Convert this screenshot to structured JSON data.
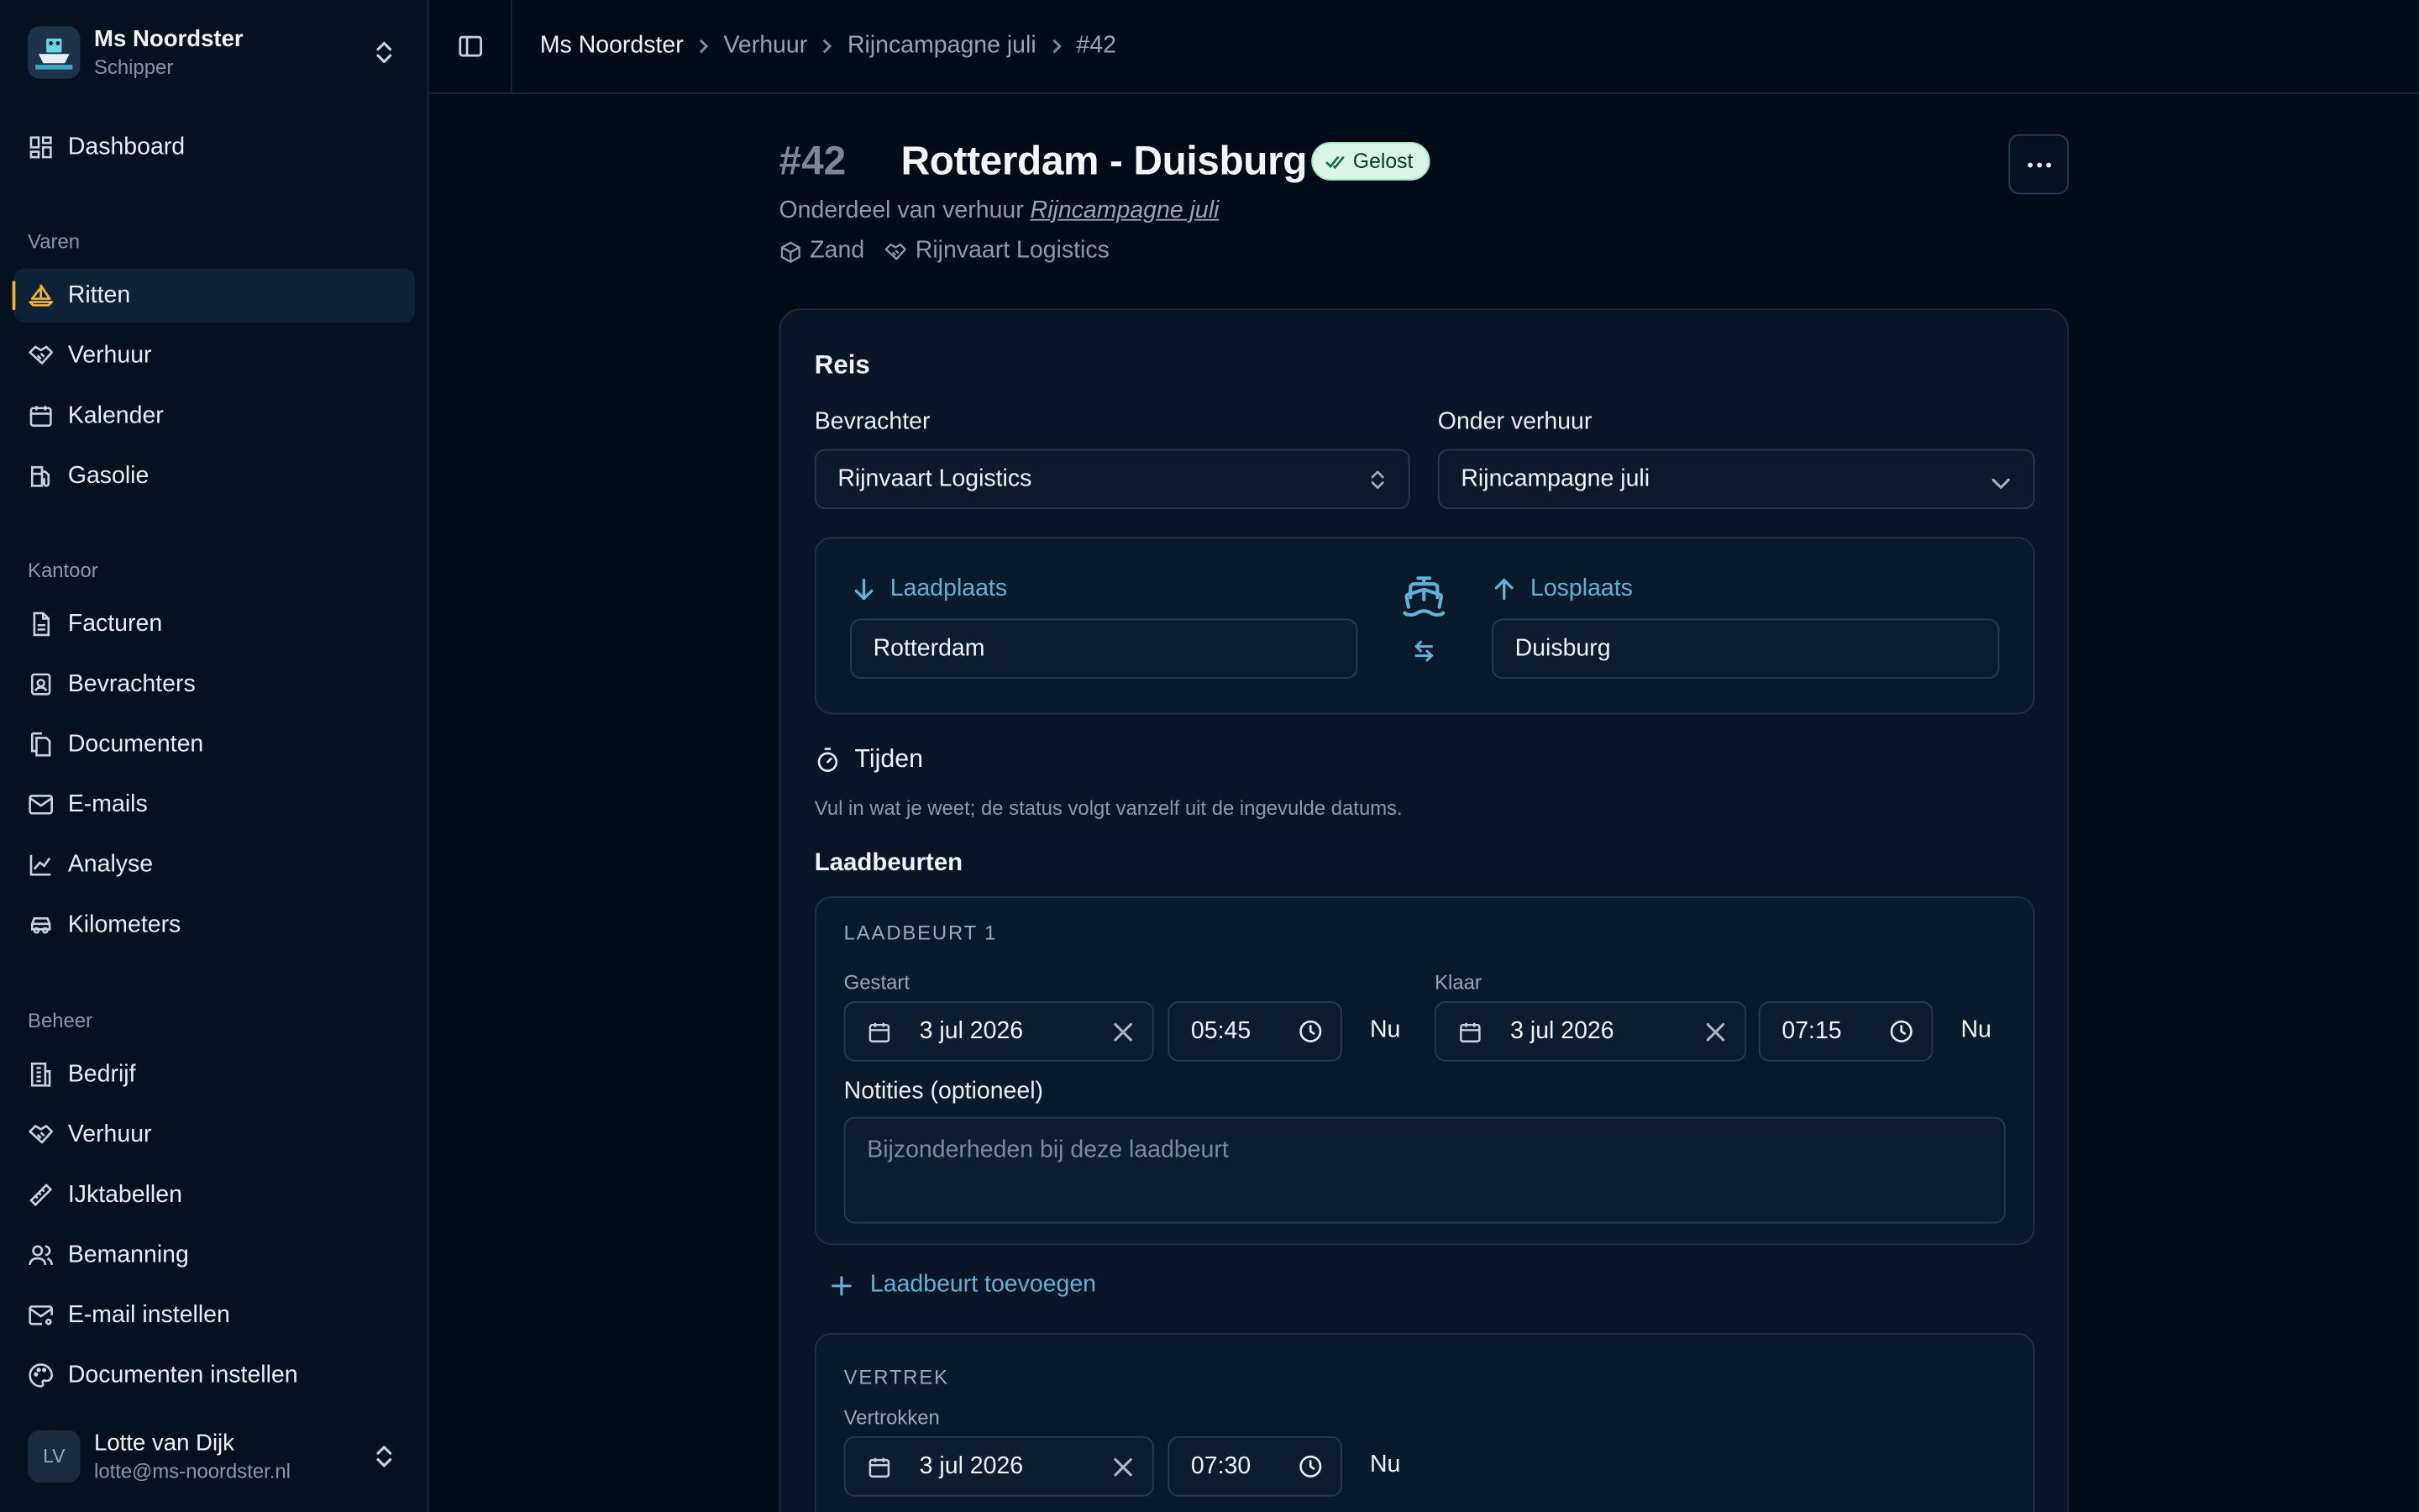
{
  "sidebar": {
    "ship": {
      "name": "Ms Noordster",
      "role": "Schipper"
    },
    "dashboard": "Dashboard",
    "sections": {
      "varen": "Varen",
      "kantoor": "Kantoor",
      "beheer": "Beheer"
    },
    "varen_items": [
      "Ritten",
      "Verhuur",
      "Kalender",
      "Gasolie"
    ],
    "kantoor_items": [
      "Facturen",
      "Bevrachters",
      "Documenten",
      "E-mails",
      "Analyse",
      "Kilometers"
    ],
    "beheer_items": [
      "Bedrijf",
      "Verhuur",
      "IJktabellen",
      "Bemanning",
      "E-mail instellen",
      "Documenten instellen"
    ],
    "active_item": "Ritten",
    "user": {
      "initials": "LV",
      "name": "Lotte van Dijk",
      "email": "lotte@ms-noordster.nl"
    }
  },
  "breadcrumb": [
    "Ms Noordster",
    "Verhuur",
    "Rijncampagne juli",
    "#42"
  ],
  "header": {
    "number": "#42",
    "title": "Rotterdam - Duisburg",
    "status": "Gelost",
    "subtitle_prefix": "Onderdeel van verhuur",
    "subtitle_link": "Rijncampagne juli",
    "cargo": "Zand",
    "charterer": "Rijnvaart Logistics"
  },
  "reis": {
    "title": "Reis",
    "bevrachter_label": "Bevrachter",
    "bevrachter_value": "Rijnvaart Logistics",
    "verhuur_label": "Onder verhuur",
    "verhuur_value": "Rijncampagne juli",
    "laadplaats_label": "Laadplaats",
    "laadplaats_value": "Rotterdam",
    "losplaats_label": "Losplaats",
    "losplaats_value": "Duisburg"
  },
  "tijden": {
    "title": "Tijden",
    "help": "Vul in wat je weet; de status volgt vanzelf uit de ingevulde datums.",
    "laadbeurten_label": "Laadbeurten",
    "laadbeurt": {
      "label": "LAADBEURT 1",
      "gestart_label": "Gestart",
      "gestart_date": "3 jul 2026",
      "gestart_time": "05:45",
      "klaar_label": "Klaar",
      "klaar_date": "3 jul 2026",
      "klaar_time": "07:15",
      "now_label": "Nu",
      "notes_label": "Notities (optioneel)",
      "notes_placeholder": "Bijzonderheden bij deze laadbeurt"
    },
    "add_label": "Laadbeurt toevoegen",
    "vertrek": {
      "label": "VERTREK",
      "vertrokken_label": "Vertrokken",
      "date": "3 jul 2026",
      "time": "07:30",
      "now_label": "Nu"
    }
  },
  "colors": {
    "accent": "#63b2d6",
    "active_marker": "#f0b533",
    "badge_bg": "#d8f5e6"
  }
}
